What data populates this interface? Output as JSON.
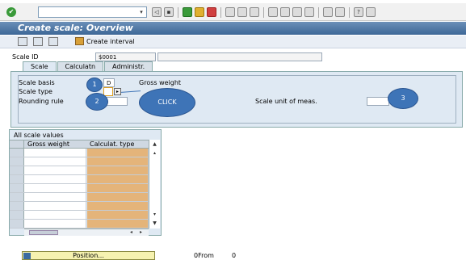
{
  "title": "Create scale: Overview",
  "toolbar": {
    "check_icon": "check-icon",
    "command_placeholder": "",
    "dropdown_glyph": "▾"
  },
  "app_toolbar": {
    "create_interval_label": "Create interval"
  },
  "header": {
    "scale_id_label": "Scale ID",
    "scale_id_value": "$0001"
  },
  "tabs": [
    {
      "label": "Scale",
      "active": true
    },
    {
      "label": "Calculatn",
      "active": false
    },
    {
      "label": "Administr.",
      "active": false
    }
  ],
  "scale_tab": {
    "scale_basis_label": "Scale basis",
    "scale_basis_value": "D",
    "scale_basis_text": "Gross weight",
    "scale_type_label": "Scale type",
    "scale_type_value": "",
    "rounding_rule_label": "Rounding rule",
    "rounding_rule_value": "",
    "unit_label": "Scale unit of meas.",
    "unit_value": ""
  },
  "callouts": {
    "one": "1",
    "two": "2",
    "three": "3",
    "click": "CLICK"
  },
  "scale_values": {
    "title": "All scale values",
    "columns": [
      "Gross weight",
      "Calculat. type"
    ],
    "row_count": 10
  },
  "footer": {
    "position_label": "Position...",
    "from_label": "0From",
    "from_value": "0"
  },
  "colors": {
    "title_bar": "#4a74a4",
    "panel": "#dfe9f3",
    "callout": "#3e74b7",
    "calc_type_cells": "#e4b47a",
    "position_button": "#f6f2b0"
  }
}
